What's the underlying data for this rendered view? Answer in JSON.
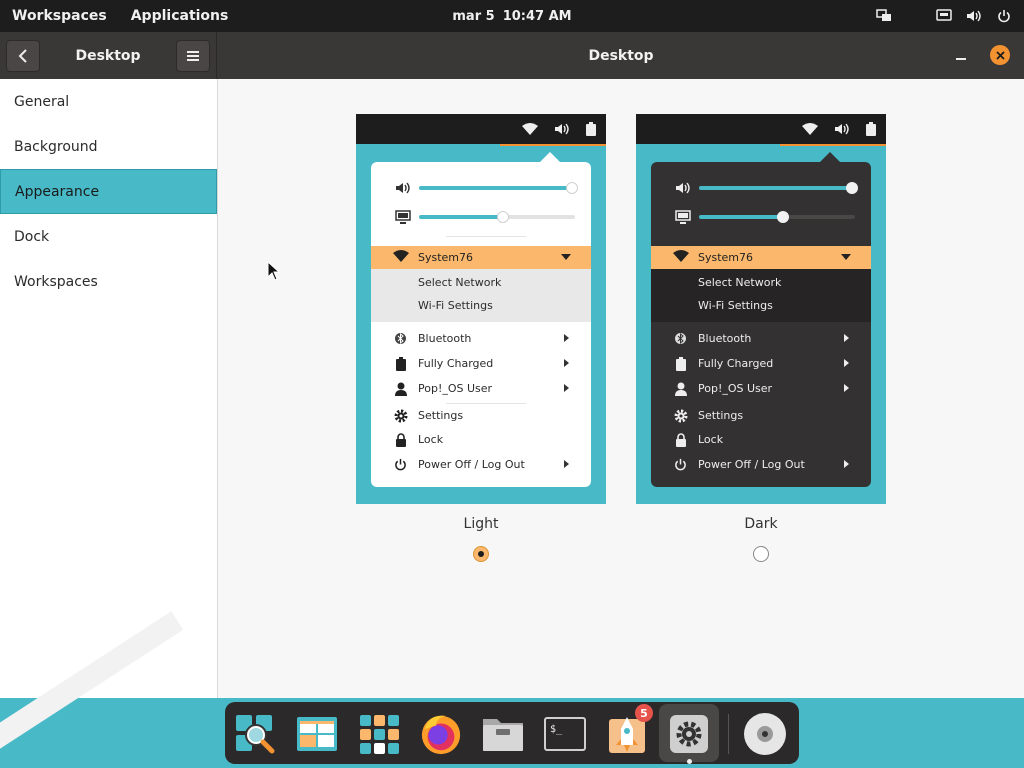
{
  "topbar": {
    "workspaces": "Workspaces",
    "applications": "Applications",
    "date": "mar 5",
    "time": "10:47 AM"
  },
  "headerbar": {
    "sidebar_title": "Desktop",
    "title": "Desktop"
  },
  "sidebar": {
    "items": [
      {
        "label": "General"
      },
      {
        "label": "Background"
      },
      {
        "label": "Appearance"
      },
      {
        "label": "Dock"
      },
      {
        "label": "Workspaces"
      }
    ],
    "selected": "Appearance"
  },
  "themes": {
    "light": {
      "label": "Light",
      "selected": true,
      "preview": {
        "network": "System76",
        "select_network": "Select Network",
        "wifi_settings": "Wi-Fi Settings",
        "bluetooth": "Bluetooth",
        "battery": "Fully Charged",
        "user": "Pop!_OS User",
        "settings": "Settings",
        "lock": "Lock",
        "power": "Power Off / Log Out",
        "volume_level": 0.98,
        "brightness_level": 0.54
      }
    },
    "dark": {
      "label": "Dark",
      "selected": false,
      "preview": {
        "network": "System76",
        "select_network": "Select Network",
        "wifi_settings": "Wi-Fi Settings",
        "bluetooth": "Bluetooth",
        "battery": "Fully Charged",
        "user": "Pop!_OS User",
        "settings": "Settings",
        "lock": "Lock",
        "power": "Power Off / Log Out",
        "volume_level": 0.98,
        "brightness_level": 0.54
      }
    }
  },
  "dock": {
    "apps": [
      {
        "name": "search-icon"
      },
      {
        "name": "workspaces-icon"
      },
      {
        "name": "applications-icon"
      },
      {
        "name": "firefox-icon"
      },
      {
        "name": "files-icon"
      },
      {
        "name": "terminal-icon"
      },
      {
        "name": "pop-shop-icon",
        "badge": "5"
      },
      {
        "name": "settings-icon",
        "active": true
      },
      {
        "name": "disc-icon"
      }
    ]
  },
  "colors": {
    "accent": "#48b9c7",
    "highlight": "#fbb86c",
    "close": "#f29231",
    "topbar": "#1d1d1d"
  }
}
